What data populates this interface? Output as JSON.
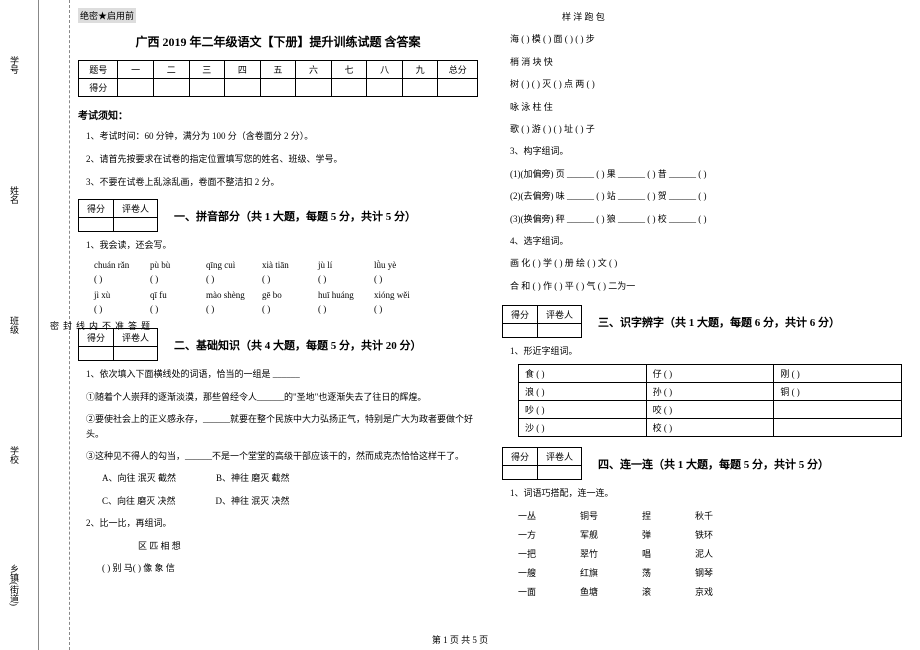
{
  "sidebar": {
    "labels_left": [
      "学号",
      "姓名",
      "班级",
      "学校",
      "乡镇(街道)"
    ],
    "labels_right": [
      "题",
      "答",
      "准",
      "不",
      "内",
      "线",
      "封",
      "密"
    ]
  },
  "header": {
    "secret": "绝密★启用前",
    "title": "广西 2019 年二年级语文【下册】提升训练试题  含答案"
  },
  "score_table": {
    "row1": [
      "题号",
      "一",
      "二",
      "三",
      "四",
      "五",
      "六",
      "七",
      "八",
      "九",
      "总分"
    ],
    "row2_label": "得分"
  },
  "notice": {
    "heading": "考试须知：",
    "items": [
      "1、考试时间：60 分钟，满分为 100 分（含卷面分 2 分）。",
      "2、请首先按要求在试卷的指定位置填写您的姓名、班级、学号。",
      "3、不要在试卷上乱涂乱画，卷面不整洁扣 2 分。"
    ]
  },
  "small_score": {
    "c1": "得分",
    "c2": "评卷人"
  },
  "sections": {
    "s1": "一、拼音部分（共 1 大题，每题 5 分，共计 5 分）",
    "s2": "二、基础知识（共 4 大题，每题 5 分，共计 20 分）",
    "s3": "三、识字辨字（共 1 大题，每题 6 分，共计 6 分）",
    "s4": "四、连一连（共 1 大题，每题 5 分，共计 5 分）"
  },
  "q1": {
    "prompt": "1、我会读，还会写。",
    "row1": [
      "chuán rǎn",
      "pù bù",
      "qīng cuì",
      "xià tiān",
      "jù lí",
      "lǜu yè"
    ],
    "row2": [
      "jì xù",
      "qī fu",
      "mào shèng",
      "gē bo",
      "huī huáng",
      "xióng wěi"
    ],
    "paren": "(      )"
  },
  "q2_basic": {
    "q1": {
      "lead": "1、依次填入下面横线处的词语，恰当的一组是 ______",
      "l1": "①随着个人崇拜的逐渐淡漠，那些曾经令人______的\"圣地\"也逐渐失去了往日的辉煌。",
      "l2": "②要使社会上的正义感永存，______就要在整个民族中大力弘扬正气，特别是广大为政者要做个好头。",
      "l3": "③这种见不得人的勾当，______不是一个堂堂的高级干部应该干的，然而成克杰恰恰这样干了。",
      "optA": "A、向往   泯灭   截然",
      "optB": "B、神往   磨灭   截然",
      "optC": "C、向往   磨灭   决然",
      "optD": "D、神往   泯灭   决然"
    },
    "q2": {
      "lead": "2、比一比，再组词。",
      "row_a": "区      匹      相      想",
      "row_b": "(      )   别 马(      )   像      象    信"
    }
  },
  "right_col": {
    "group_top": {
      "header": "样      洋      跑      包",
      "lines": [
        "海 (      )      模 (      )      面 (      )      (      ) 步",
        "          梢      消      块      快",
        "树 (      )      (      ) 灭      (      ) 点      两 (      )",
        "          咏      泳      柱      住",
        "歌 (      )      游 (      )      (      ) 址      (      ) 子"
      ]
    },
    "q3": {
      "lead": "3、构字组词。",
      "l1": "(1)(加偏旁) 页  ______ (      )  果  ______ (      )  昔  ______ (      )",
      "l2": "(2)(去偏旁) 味  ______ (      )  站  ______ (      )  贺  ______ (      )",
      "l3": "(3)(换偏旁) 秤  ______ (      )  狼  ______ (      )  校  ______ (      )"
    },
    "q4": {
      "lead": "4、选字组词。",
      "l1": "画  化  (      )  学  (      )  册  绘  (      )  文  (      )",
      "l2": "合  和  (      )  作  (      )  平  (      )  气  (      )  二为一"
    }
  },
  "char_table": {
    "lead": "1、形近字组词。",
    "rows": [
      [
        "食 (      )",
        "仔 (      )",
        "刚 (      )"
      ],
      [
        "浪 (      )",
        "孙 (      )",
        "铜 (      )"
      ],
      [
        "吵 (      )",
        "咬 (      )",
        ""
      ],
      [
        "沙 (      )",
        "校 (      )",
        ""
      ]
    ]
  },
  "match": {
    "lead": "1、词语巧搭配，连一连。",
    "rows": [
      [
        "一丛",
        "铜号",
        "捏",
        "秋千"
      ],
      [
        "一方",
        "军舰",
        "弹",
        "铁环"
      ],
      [
        "一把",
        "翠竹",
        "唱",
        "泥人"
      ],
      [
        "一艘",
        "红旗",
        "荡",
        "钢琴"
      ],
      [
        "一面",
        "鱼塘",
        "滚",
        "京戏"
      ]
    ]
  },
  "footer": "第 1 页 共 5 页"
}
